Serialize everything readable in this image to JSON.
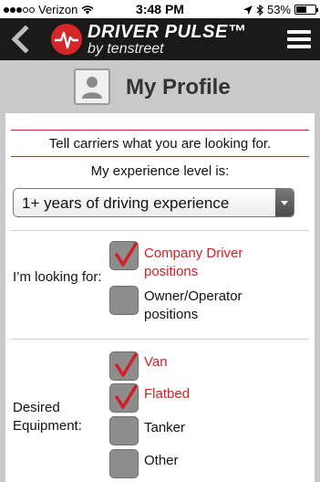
{
  "status_bar": {
    "carrier": "Verizon",
    "time": "3:48 PM",
    "battery": "53%",
    "battery_level": 0.53
  },
  "header": {
    "brand_name": "DRIVER PULSE™",
    "brand_sub": "by tenstreet",
    "icons": [
      "back-chevron-icon",
      "pulse-logo-icon",
      "hamburger-menu-icon"
    ]
  },
  "profile": {
    "title": "My Profile"
  },
  "form": {
    "tagline": "Tell carriers what you are looking for.",
    "experience_label": "My experience level is:",
    "experience_value": "1+ years of driving experience",
    "looking_label": "I’m looking for:",
    "looking_options": [
      {
        "label": "Company Driver positions",
        "checked": true
      },
      {
        "label": "Owner/Operator positions",
        "checked": false
      }
    ],
    "equipment_label": "Desired Equipment:",
    "equipment_options": [
      {
        "label": "Van",
        "checked": true
      },
      {
        "label": "Flatbed",
        "checked": true
      },
      {
        "label": "Tanker",
        "checked": false
      },
      {
        "label": "Other",
        "checked": false
      }
    ]
  },
  "colors": {
    "accent_red": "#d21f26",
    "header_bg": "#1a1a1a",
    "page_bg": "#c9c9c9"
  }
}
